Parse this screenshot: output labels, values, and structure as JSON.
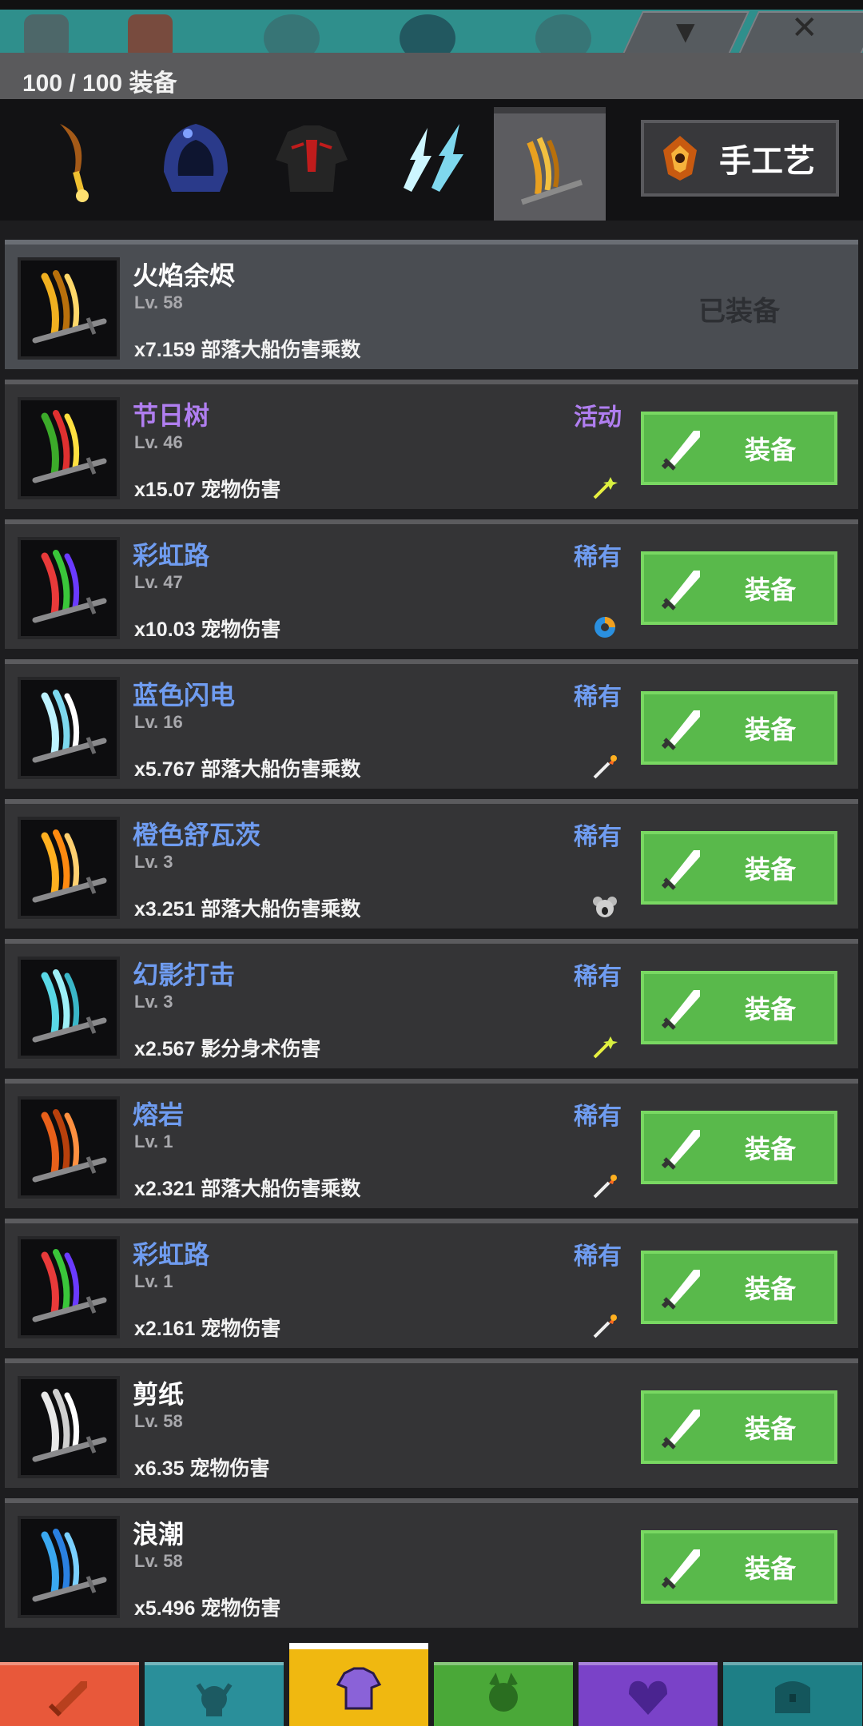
{
  "header": {
    "count_label": "100 / 100 装备",
    "craft_label": "手工艺"
  },
  "category_tabs": [
    {
      "name": "weapon-category-tab",
      "icon": "axe-icon",
      "active": false
    },
    {
      "name": "hood-category-tab",
      "icon": "hood-icon",
      "active": false
    },
    {
      "name": "armor-category-tab",
      "icon": "jacket-icon",
      "active": false
    },
    {
      "name": "aura-category-tab",
      "icon": "lightning-icon",
      "active": false
    },
    {
      "name": "slash-category-tab",
      "icon": "flame-slash-icon",
      "active": true
    }
  ],
  "items": [
    {
      "name": "火焰余烬",
      "level": "Lv. 58",
      "stat": "x7.159 部落大船伤害乘数",
      "rarity": "",
      "status": "已装备",
      "equipped": true,
      "name_color": "white",
      "colors": [
        "#f0b020",
        "#b8700c",
        "#ffd86a"
      ],
      "mini_icon": ""
    },
    {
      "name": "节日树",
      "level": "Lv. 46",
      "stat": "x15.07 宠物伤害",
      "rarity": "活动",
      "status": "装备",
      "equipped": false,
      "name_color": "purple",
      "colors": [
        "#3caa2a",
        "#e03030",
        "#ffe040"
      ],
      "mini_icon": "sparkle-wand-icon"
    },
    {
      "name": "彩虹路",
      "level": "Lv. 47",
      "stat": "x10.03 宠物伤害",
      "rarity": "稀有",
      "status": "装备",
      "equipped": false,
      "name_color": "blue",
      "colors": [
        "#e83a3a",
        "#3ac63a",
        "#6a3aff"
      ],
      "mini_icon": "swirl-icon"
    },
    {
      "name": "蓝色闪电",
      "level": "Lv. 16",
      "stat": "x5.767 部落大船伤害乘数",
      "rarity": "稀有",
      "status": "装备",
      "equipped": false,
      "name_color": "blue",
      "colors": [
        "#bdf2ff",
        "#7dd8ee",
        "#ffffff"
      ],
      "mini_icon": "fire-arrow-icon"
    },
    {
      "name": "橙色舒瓦茨",
      "level": "Lv. 3",
      "stat": "x3.251 部落大船伤害乘数",
      "rarity": "稀有",
      "status": "装备",
      "equipped": false,
      "name_color": "blue",
      "colors": [
        "#ffb020",
        "#ff8a10",
        "#ffd070"
      ],
      "mini_icon": "koala-icon"
    },
    {
      "name": "幻影打击",
      "level": "Lv. 3",
      "stat": "x2.567 影分身术伤害",
      "rarity": "稀有",
      "status": "装备",
      "equipped": false,
      "name_color": "blue",
      "colors": [
        "#5ad8e6",
        "#9ef0f8",
        "#3ab6c8"
      ],
      "mini_icon": "sparkle-wand-icon"
    },
    {
      "name": "熔岩",
      "level": "Lv. 1",
      "stat": "x2.321 部落大船伤害乘数",
      "rarity": "稀有",
      "status": "装备",
      "equipped": false,
      "name_color": "blue",
      "colors": [
        "#e8601a",
        "#b8400c",
        "#ff9040"
      ],
      "mini_icon": "fire-arrow-icon"
    },
    {
      "name": "彩虹路",
      "level": "Lv. 1",
      "stat": "x2.161 宠物伤害",
      "rarity": "稀有",
      "status": "装备",
      "equipped": false,
      "name_color": "blue",
      "colors": [
        "#e83a3a",
        "#3ac63a",
        "#6a3aff"
      ],
      "mini_icon": "fire-arrow-icon"
    },
    {
      "name": "剪纸",
      "level": "Lv. 58",
      "stat": "x6.35 宠物伤害",
      "rarity": "",
      "status": "装备",
      "equipped": false,
      "name_color": "white",
      "colors": [
        "#e8e8e8",
        "#cfcfcf",
        "#ffffff"
      ],
      "mini_icon": ""
    },
    {
      "name": "浪潮",
      "level": "Lv. 58",
      "stat": "x5.496 宠物伤害",
      "rarity": "",
      "status": "装备",
      "equipped": false,
      "name_color": "white",
      "colors": [
        "#3aa8f0",
        "#2a80e0",
        "#7ad0ff"
      ],
      "mini_icon": ""
    }
  ],
  "bottom_nav": [
    {
      "name": "nav-tab-weapon",
      "icon": "sword-icon",
      "color": "#e8583a",
      "active": false
    },
    {
      "name": "nav-tab-hero",
      "icon": "viking-icon",
      "color": "#2a8f9a",
      "active": false
    },
    {
      "name": "nav-tab-gear",
      "icon": "shirt-icon",
      "color": "#f0b810",
      "active": true
    },
    {
      "name": "nav-tab-pets",
      "icon": "pet-icon",
      "color": "#4aa838",
      "active": false
    },
    {
      "name": "nav-tab-guild",
      "icon": "heart-crest-icon",
      "color": "#7a42c8",
      "active": false
    },
    {
      "name": "nav-tab-chest",
      "icon": "chest-icon",
      "color": "#1e7f86",
      "active": false
    }
  ]
}
